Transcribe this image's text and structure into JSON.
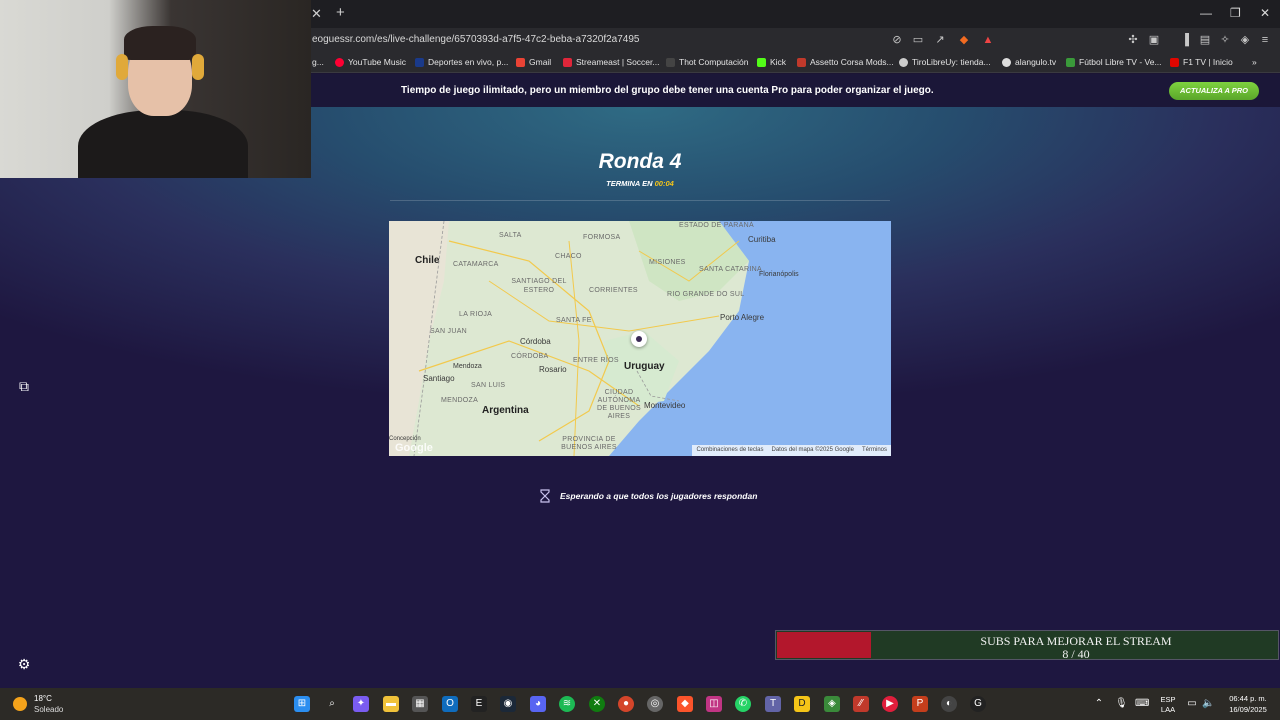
{
  "browser": {
    "url": "eoguessr.com/es/live-challenge/6570393d-a7f5-47c2-beba-a7320f2a7495",
    "bookmarks": [
      {
        "label": "g...",
        "color": "#888888"
      },
      {
        "label": "YouTube Music",
        "color": "#ff0033"
      },
      {
        "label": "Deportes en vivo, p...",
        "color": "#1a3a8a"
      },
      {
        "label": "Gmail",
        "color": "#ea4335"
      },
      {
        "label": "Streameast | Soccer...",
        "color": "#e0263a"
      },
      {
        "label": "Thot Computación",
        "color": "#444444"
      },
      {
        "label": "Kick",
        "color": "#53fc18"
      },
      {
        "label": "Assetto Corsa Mods...",
        "color": "#c0392b"
      },
      {
        "label": "TiroLibreUy: tienda...",
        "color": "#cccccc"
      },
      {
        "label": "alangulo.tv",
        "color": "#dddddd"
      },
      {
        "label": "Fútbol Libre TV - Ve...",
        "color": "#3a9a3a"
      },
      {
        "label": "F1 TV | Inicio",
        "color": "#e10600"
      }
    ]
  },
  "promo": {
    "text": "Tiempo de juego ilimitado, pero un miembro del grupo debe tener una cuenta Pro para poder organizar el juego.",
    "button": "ACTUALIZA A PRO"
  },
  "game": {
    "round_title": "Ronda 4",
    "ends_label": "TERMINA EN",
    "timer": "00:04",
    "waiting": "Esperando a que todos los jugadores respondan"
  },
  "map": {
    "countries": [
      "Chile",
      "Argentina",
      "Uruguay"
    ],
    "cities": [
      "Curitiba",
      "Florianópolis",
      "Porto Alegre",
      "Córdoba",
      "Rosario",
      "Mendoza",
      "Santiago",
      "Montevideo",
      "Concepción"
    ],
    "states": [
      "ESTADO DE PARANÁ",
      "SALTA",
      "FORMOSA",
      "CATAMARCA",
      "CHACO",
      "MISIONES",
      "SANTA CATARINA",
      "SANTIAGO DEL ESTERO",
      "CORRIENTES",
      "RIO GRANDE DO SUL",
      "LA RIOJA",
      "SANTA FE",
      "SAN JUAN",
      "CÓRDOBA",
      "ENTRE RÍOS",
      "SAN LUIS",
      "MENDOZA",
      "CIUDAD AUTÓNOMA DE BUENOS AIRES",
      "PROVINCIA DE BUENOS AIRES"
    ],
    "footer": [
      "Combinaciones de teclas",
      "Datos del mapa ©2025 Google",
      "Términos"
    ],
    "google": "Google"
  },
  "subs": {
    "title": "SUBS PARA MEJORAR EL STREAM",
    "count": "8 / 40",
    "progress": 0.2
  },
  "taskbar": {
    "temp": "18°C",
    "weather": "Soleado",
    "lang_top": "ESP",
    "lang_bottom": "LAA",
    "time": "06:44 p. m.",
    "date": "16/09/2025"
  }
}
